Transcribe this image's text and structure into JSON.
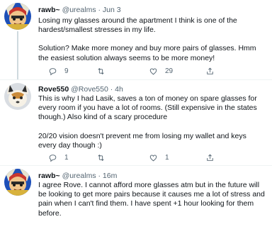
{
  "tweets": [
    {
      "display_name": "rawb~",
      "handle": "@urealms",
      "separator": "·",
      "time": "Jun 3",
      "paragraphs": [
        "Losing my glasses around the apartment I think is one of the hardest/smallest stresses in my life.",
        "Solution? Make more money and buy more pairs of glasses. Hmm the easiest solution always seems to be more money!"
      ],
      "counts": {
        "reply": "9",
        "retweet": "",
        "like": "29"
      }
    },
    {
      "display_name": "Rove550",
      "handle": "@Rove550",
      "separator": "·",
      "time": "4h",
      "paragraphs": [
        "This is why I had Lasik, saves a ton of money on spare glasses for every room if you have a lot of rooms. (Still expensive in the states though.) Also kind of a scary procedure",
        "20/20 vision doesn't prevent me from losing my wallet and keys every day though :)"
      ],
      "counts": {
        "reply": "1",
        "retweet": "",
        "like": "1"
      }
    },
    {
      "display_name": "rawb~",
      "handle": "@urealms",
      "separator": "·",
      "time": "16m",
      "paragraphs": [
        "I agree Rove. I cannot afford more glasses atm but in the future will be looking to get more pairs because it causes me a lot of stress and pain when I can't find them. I have spent +1 hour looking for them before."
      ],
      "counts": {
        "reply": "",
        "retweet": "",
        "like": ""
      }
    }
  ],
  "icons": {
    "reply": "reply-icon",
    "retweet": "retweet-icon",
    "like": "like-icon",
    "share": "share-icon"
  },
  "colors": {
    "text": "#0f1419",
    "muted": "#536471",
    "thread_line": "#cfd9de",
    "divider": "#eff3f4"
  }
}
